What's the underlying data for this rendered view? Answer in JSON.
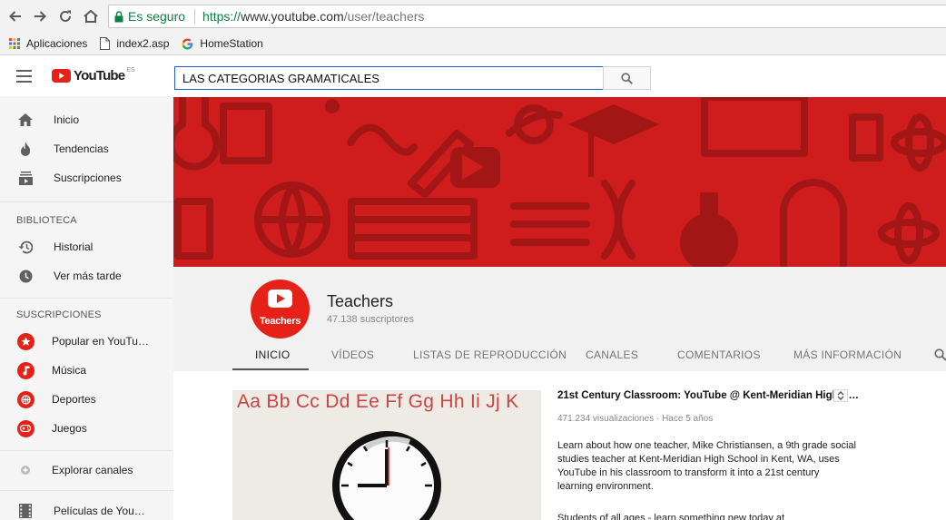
{
  "browser": {
    "secure_label": "Es seguro",
    "url_scheme": "https://",
    "url_host": "www.youtube.com",
    "url_path": "/user/teachers",
    "bookmarks": [
      {
        "label": "Aplicaciones",
        "icon": "apps-grid-icon"
      },
      {
        "label": "index2.asp",
        "icon": "page-icon"
      },
      {
        "label": "HomeStation",
        "icon": "google-icon"
      }
    ]
  },
  "masthead": {
    "logo_text": "YouTube",
    "logo_region": "ES",
    "search_value": "LAS CATEGORIAS GRAMATICALES"
  },
  "sidebar": {
    "main_items": [
      {
        "label": "Inicio",
        "icon": "home-icon"
      },
      {
        "label": "Tendencias",
        "icon": "flame-icon"
      },
      {
        "label": "Suscripciones",
        "icon": "subscriptions-icon"
      }
    ],
    "library_heading": "BIBLIOTECA",
    "library_items": [
      {
        "label": "Historial",
        "icon": "history-icon"
      },
      {
        "label": "Ver más tarde",
        "icon": "clock-icon"
      }
    ],
    "subs_heading": "SUSCRIPCIONES",
    "subs_items": [
      {
        "label": "Popular en YouTu…",
        "icon": "star-icon"
      },
      {
        "label": "Música",
        "icon": "music-icon"
      },
      {
        "label": "Deportes",
        "icon": "ball-icon"
      },
      {
        "label": "Juegos",
        "icon": "gamepad-icon"
      }
    ],
    "explore_label": "Explorar canales",
    "movies_label": "Películas de You…"
  },
  "channel": {
    "avatar_label": "Teachers",
    "name": "Teachers",
    "subscribers": "47.138 suscriptores",
    "tabs": [
      "INICIO",
      "VÍDEOS",
      "LISTAS DE REPRODUCCIÓN",
      "CANALES",
      "COMENTARIOS",
      "MÁS INFORMACIÓN"
    ],
    "active_tab": "INICIO"
  },
  "featured_video": {
    "thumbnail_text": "Aa Bb Cc Dd Ee Ff Gg Hh Ii Jj K",
    "title": "21st Century Classroom: YouTube @ Kent-Meridian High S…",
    "views": "471.234 visualizaciones",
    "age": "Hace 5 años",
    "description": "Learn about how one teacher, Mike Christiansen, a 9th grade social studies teacher at Kent-Meridian High School in Kent, WA, uses YouTube in his classroom to transform it into a 21st century learning environment.",
    "description_2": "Students of all ages - learn something new today at"
  },
  "colors": {
    "youtube_red": "#e62117",
    "banner_red": "#cf1d1d",
    "secure_green": "#0b8043",
    "search_border": "#1c62b9"
  }
}
